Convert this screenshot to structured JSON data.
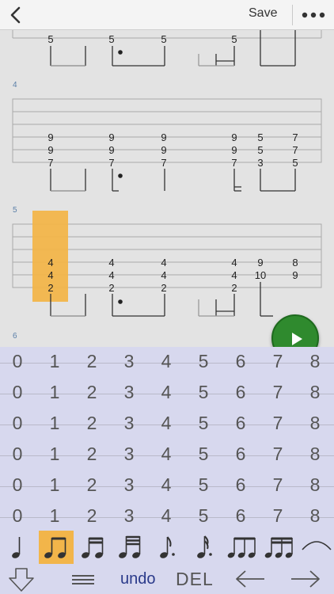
{
  "toolbar": {
    "save_label": "Save",
    "back_icon": "chevron-left-icon",
    "more_icon": "more-dots-icon"
  },
  "measures": [
    {
      "number": "4"
    },
    {
      "number": "5"
    },
    {
      "number": "6"
    }
  ],
  "top_partial_frets": [
    "5",
    "5",
    "5",
    "5"
  ],
  "measure4": {
    "columns": [
      [
        "9",
        "9",
        "7"
      ],
      [
        "9",
        "9",
        "7"
      ],
      [
        "9",
        "9",
        "7"
      ],
      [
        "9",
        "9",
        "7"
      ],
      [
        "5",
        "5",
        "3"
      ],
      [
        "7",
        "7",
        "5"
      ]
    ]
  },
  "measure5": {
    "columns": [
      [
        "4",
        "4",
        "2"
      ],
      [
        "4",
        "4",
        "2"
      ],
      [
        "4",
        "4",
        "2"
      ],
      [
        "4",
        "4",
        "2"
      ],
      [
        "9",
        "10",
        ""
      ],
      [
        "8",
        "9",
        ""
      ]
    ]
  },
  "keyboard": {
    "rows": [
      [
        "0",
        "1",
        "2",
        "3",
        "4",
        "5",
        "6",
        "7",
        "8"
      ],
      [
        "0",
        "1",
        "2",
        "3",
        "4",
        "5",
        "6",
        "7",
        "8"
      ],
      [
        "0",
        "1",
        "2",
        "3",
        "4",
        "5",
        "6",
        "7",
        "8"
      ],
      [
        "0",
        "1",
        "2",
        "3",
        "4",
        "5",
        "6",
        "7",
        "8"
      ],
      [
        "0",
        "1",
        "2",
        "3",
        "4",
        "5",
        "6",
        "7",
        "8"
      ],
      [
        "0",
        "1",
        "2",
        "3",
        "4",
        "5",
        "6",
        "7",
        "8"
      ]
    ]
  },
  "durations": {
    "items": [
      "quarter-note-icon",
      "eighth-notes-icon",
      "sixteenth-notes-icon",
      "thirtysecond-notes-icon",
      "dotted-eighth-icon",
      "dotted-sixteenth-icon",
      "triplet-eighths-icon",
      "triplet-sixteenths-icon",
      "tie-icon"
    ],
    "selected": "eighth-notes-icon"
  },
  "bottom": {
    "undo_label": "undo",
    "del_label": "DEL"
  },
  "colors": {
    "selection": "#f2b54a",
    "play": "#2f8a2e",
    "keyboard_bg": "#d7d8ee",
    "undo_text": "#2a3a8a"
  }
}
